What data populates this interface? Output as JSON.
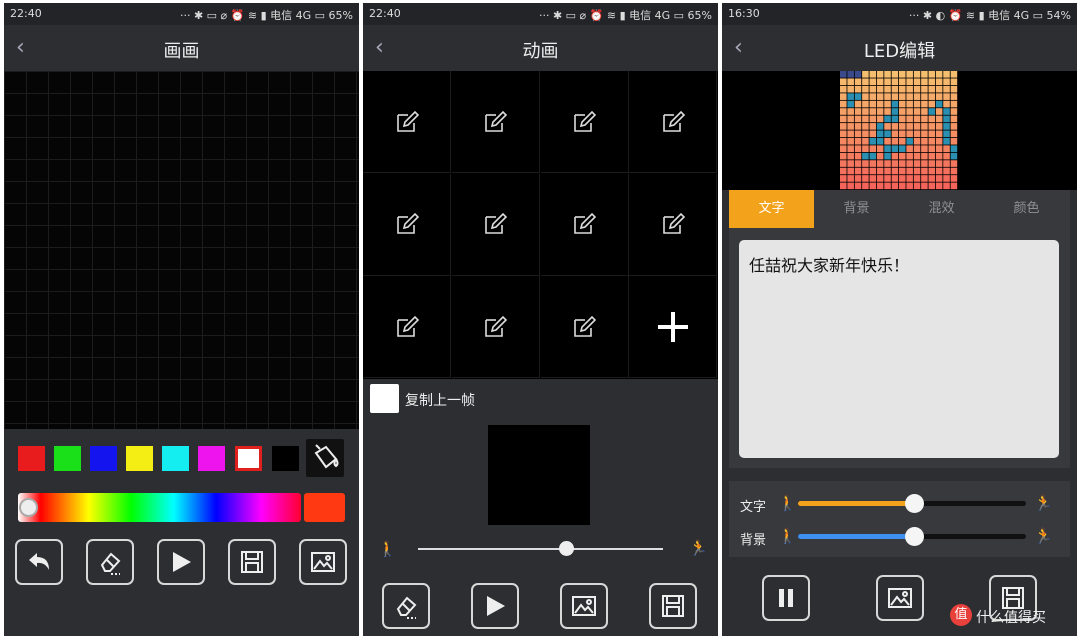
{
  "screens": [
    {
      "status": {
        "time": "22:40",
        "icons": "··· ✱ ▭ ⌀ ⏰ ≋ ▮ 电信 4G ▭ 65%"
      },
      "title": "画画",
      "palette": [
        "#e81c1c",
        "#19e019",
        "#1414ee",
        "#f4ee14",
        "#14eef0",
        "#ee14ee",
        "#ffffff",
        "#000000"
      ],
      "selected_color": "#ff3a12",
      "hue_slider_value": 0.04,
      "tool_icons": [
        "undo-icon",
        "eraser-icon",
        "play-icon",
        "save-icon",
        "image-icon"
      ]
    },
    {
      "status": {
        "time": "22:40",
        "icons": "··· ✱ ▭ ⌀ ⏰ ≋ ▮ 电信 4G ▭ 65%"
      },
      "title": "动画",
      "frame_count": 11,
      "add_frame_icon": "plus-icon",
      "copy_prev_label": "复制上一帧",
      "speed_value": 0.62,
      "tool_icons": [
        "eraser-icon",
        "play-icon",
        "image-icon",
        "save-icon"
      ]
    },
    {
      "status": {
        "time": "16:30",
        "icons": "··· ✱ ◐ ⏰ ≋ ▮ 电信 4G ▭ 54%"
      },
      "title": "LED编辑",
      "tabs": [
        "文字",
        "背景",
        "混效",
        "颜色"
      ],
      "active_tab": "文字",
      "text_value": "任喆祝大家新年快乐！",
      "sliders": [
        {
          "label": "文字",
          "value": 0.6,
          "color": "#f3a21c"
        },
        {
          "label": "背景",
          "value": 0.6,
          "color": "#3d8ff0"
        }
      ],
      "tool_icons": [
        "pause-icon",
        "image-icon",
        "save-icon"
      ],
      "watermark": "什么值得买"
    }
  ],
  "colors": {
    "accent_orange": "#f3a21c",
    "accent_blue": "#3d8ff0",
    "panel": "#2c2e31"
  }
}
